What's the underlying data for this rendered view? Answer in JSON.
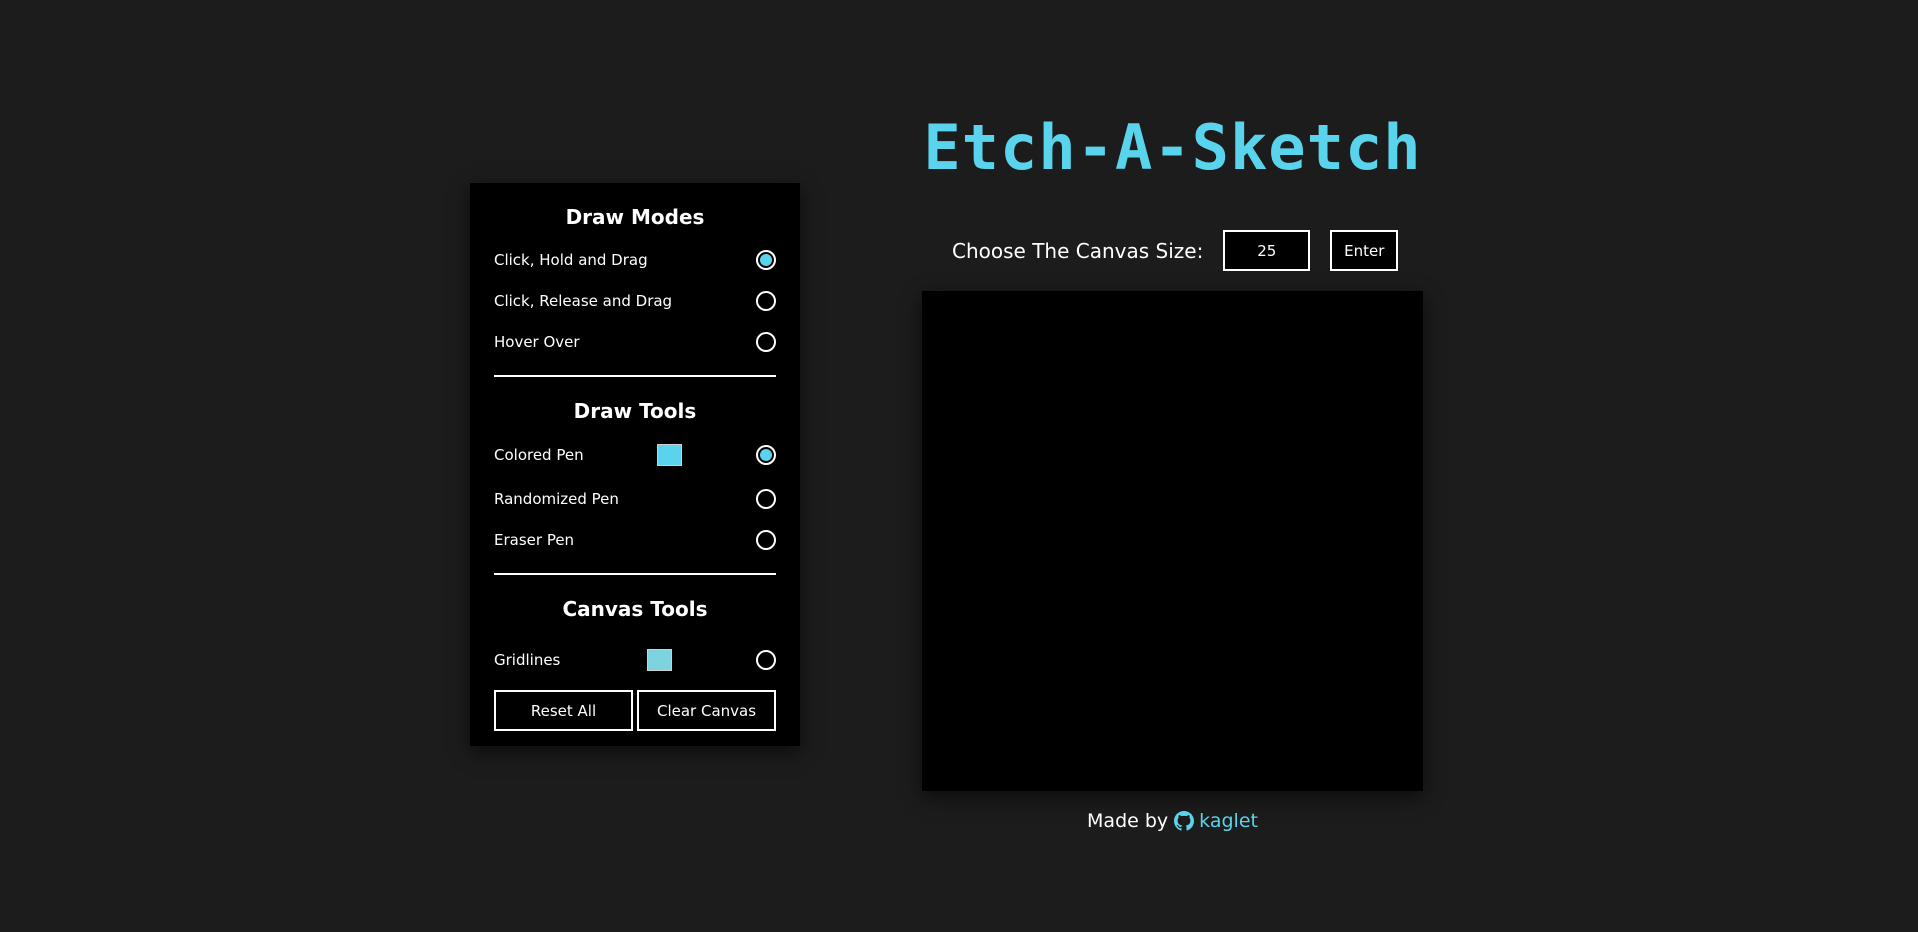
{
  "app_title": "Etch-A-Sketch",
  "colors": {
    "accent": "#5ad3ec",
    "background": "#1c1c1c",
    "panel": "#000000",
    "pen_color": "#5ad3ec",
    "grid_color": "#7dd3e0"
  },
  "draw_modes": {
    "title": "Draw Modes",
    "options": [
      {
        "label": "Click, Hold and Drag",
        "selected": true
      },
      {
        "label": "Click, Release and Drag",
        "selected": false
      },
      {
        "label": "Hover Over",
        "selected": false
      }
    ]
  },
  "draw_tools": {
    "title": "Draw Tools",
    "options": [
      {
        "label": "Colored Pen",
        "selected": true,
        "has_color": true
      },
      {
        "label": "Randomized Pen",
        "selected": false
      },
      {
        "label": "Eraser Pen",
        "selected": false
      }
    ]
  },
  "canvas_tools": {
    "title": "Canvas Tools",
    "options": [
      {
        "label": "Gridlines",
        "selected": false,
        "has_color": true
      }
    ],
    "reset_label": "Reset All",
    "clear_label": "Clear Canvas"
  },
  "canvas_size": {
    "label": "Choose The Canvas Size:",
    "value": "25",
    "enter_label": "Enter"
  },
  "footer": {
    "prefix": "Made by",
    "author": "kaglet",
    "icon": "github-icon"
  }
}
